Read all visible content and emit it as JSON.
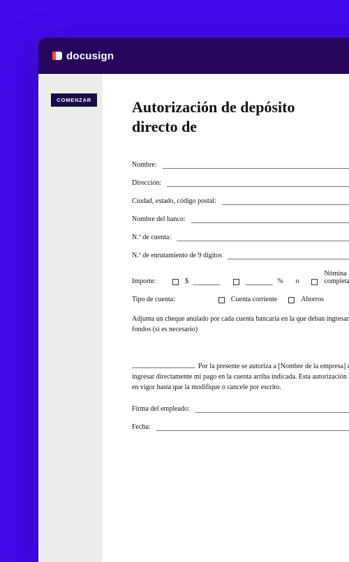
{
  "brand": {
    "name": "docusign"
  },
  "sidebar": {
    "start_label": "COMENZAR"
  },
  "doc": {
    "title_line1": "Autorización de depósito",
    "title_line2": "directo de",
    "fields": {
      "name": "Nombre:",
      "address": "Dirección:",
      "city_state_zip": "Ciudad, estado, código postal:",
      "bank_name": "Nombre del banco:",
      "account_no": "N.º de cuenta:",
      "routing_no": "N.º de enrutamiento de 9 dígitos",
      "amount_label": "Importe:",
      "currency": "$",
      "percent": "%",
      "or": "o",
      "full_payroll": "Nómina completa",
      "account_type": "Tipo de cuenta:",
      "checking": "Cuenta corriente",
      "savings": "Ahorros",
      "employee_sig": "Firma del empleado:",
      "date": "Fecha:"
    },
    "note": "Adjunta un cheque anulado por cada cuenta bancaria en la que deban ingresarse los fondos (si es necesario)",
    "auth_text": "Por la presente se autoriza a [Nombre de la empresa] a ingresar directamente mi pago en la cuenta arriba indicada. Esta autorización seguirá en vigor hasta que la modifique o cancele por escrito."
  }
}
